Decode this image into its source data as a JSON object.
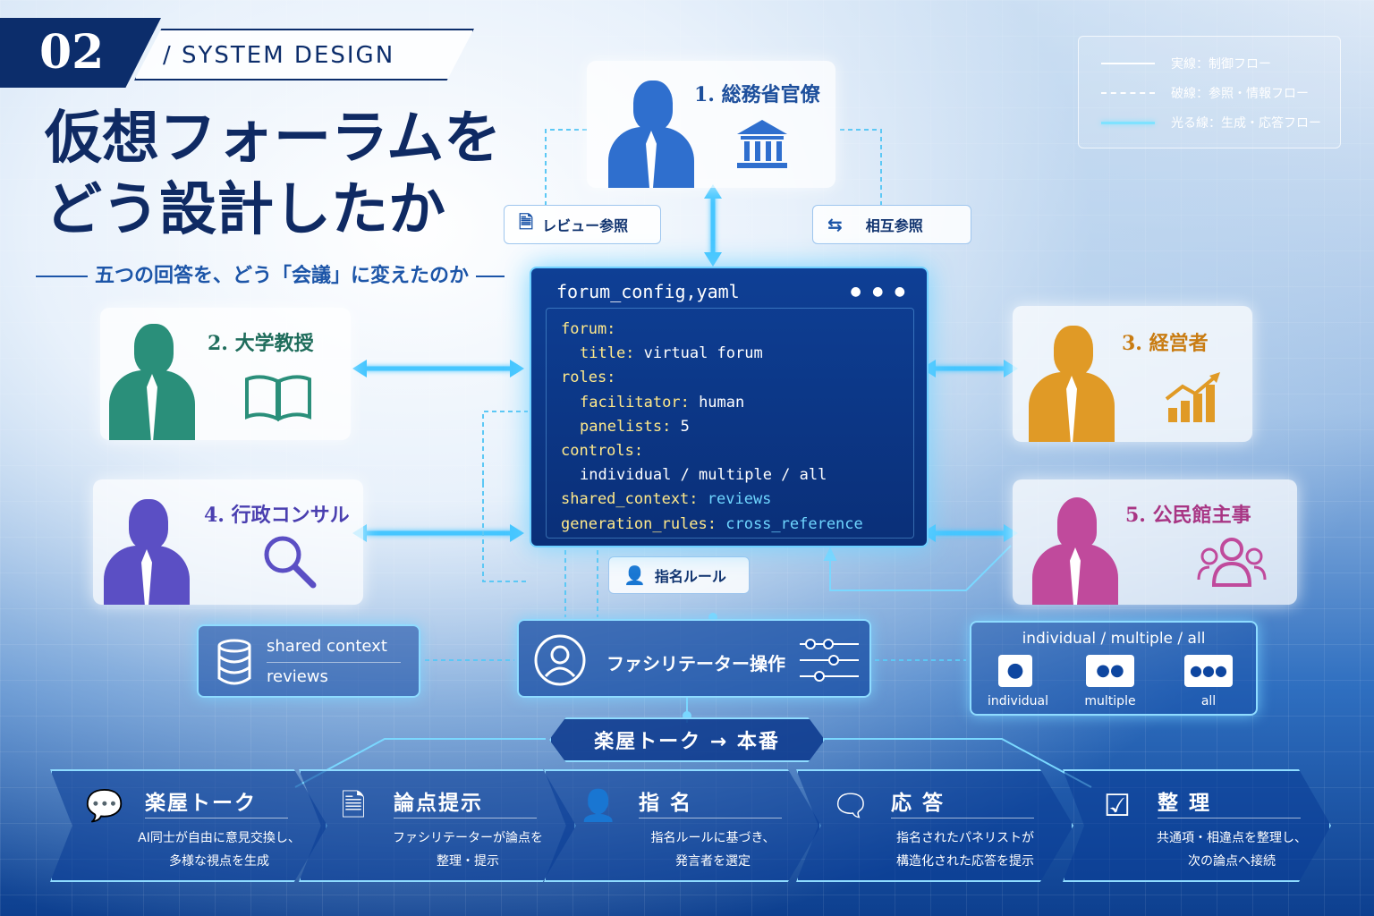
{
  "header": {
    "number": "02",
    "section": "/ SYSTEM DESIGN",
    "title": "仮想フォーラムを\nどう設計したか",
    "tagline": "五つの回答を、どう「会議」に変えたのか"
  },
  "legend": [
    {
      "label": "実線：制御フロー",
      "style": "solid"
    },
    {
      "label": "破線：参照・情報フロー",
      "style": "dashed"
    },
    {
      "label": "光る線：生成・応答フロー",
      "style": "glow"
    }
  ],
  "personas": [
    {
      "label": "1. 総務省官僚",
      "icon": "government-building-icon",
      "color": "#2f6fce"
    },
    {
      "label": "2. 大学教授",
      "icon": "open-book-icon",
      "color": "#2a8f7a"
    },
    {
      "label": "3. 経営者",
      "icon": "growth-chart-icon",
      "color": "#e09a26"
    },
    {
      "label": "4. 行政コンサル",
      "icon": "magnifier-icon",
      "color": "#5b4fc4"
    },
    {
      "label": "5. 公民館主事",
      "icon": "people-group-icon",
      "color": "#c04a9c"
    }
  ],
  "tags": {
    "review": "レビュー参照",
    "mutual": "相互参照",
    "nomination": "指名ルール"
  },
  "yaml": {
    "filename": "forum_config,yaml",
    "dots": "● ● ●",
    "lines": [
      {
        "indent": 0,
        "key": "forum:",
        "val": ""
      },
      {
        "indent": 1,
        "key": "title:",
        "val": " virtual forum"
      },
      {
        "indent": 0,
        "key": "roles:",
        "val": ""
      },
      {
        "indent": 1,
        "key": "facilitator:",
        "val": " human"
      },
      {
        "indent": 1,
        "key": "panelists:",
        "val": " 5"
      },
      {
        "indent": 0,
        "key": "controls:",
        "val": ""
      },
      {
        "indent": 1,
        "key": "",
        "val": "individual / multiple / all"
      },
      {
        "indent": 0,
        "key": "shared_context:",
        "val": " reviews"
      },
      {
        "indent": 0,
        "key": "generation_rules:",
        "val": " cross_reference"
      }
    ]
  },
  "shared": {
    "line1": "shared context",
    "line2": "reviews"
  },
  "facilitator": {
    "label": "ファシリテーター操作"
  },
  "modes": {
    "title": "individual / multiple / all",
    "items": [
      "individual",
      "multiple",
      "all"
    ]
  },
  "stage": {
    "label": "楽屋トーク → 本番"
  },
  "flow": [
    {
      "title": "楽屋トーク",
      "desc1": "AI同士が自由に意見交換し、",
      "desc2": "多様な視点を生成",
      "icon": "chat-bubble-icon"
    },
    {
      "title": "論点提示",
      "desc1": "ファシリテーターが論点を",
      "desc2": "整理・提示",
      "icon": "document-icon"
    },
    {
      "title": "指 名",
      "desc1": "指名ルールに基づき、",
      "desc2": "発言者を選定",
      "icon": "person-select-icon"
    },
    {
      "title": "応 答",
      "desc1": "指名されたパネリストが",
      "desc2": "構造化された応答を提示",
      "icon": "speech-icon"
    },
    {
      "title": "整 理",
      "desc1": "共通項・相違点を整理し、",
      "desc2": "次の論点へ接続",
      "icon": "checklist-icon"
    }
  ]
}
